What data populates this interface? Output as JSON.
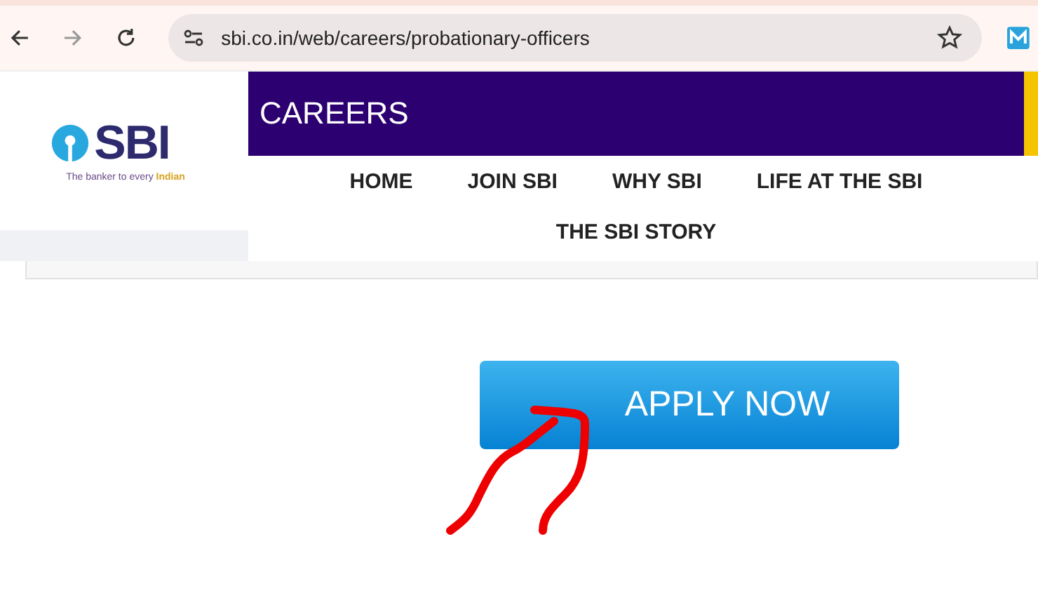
{
  "browser": {
    "url": "sbi.co.in/web/careers/probationary-officers",
    "bookmarked": false
  },
  "logo": {
    "name": "SBI",
    "tagline": "The banker to every ",
    "tagline_highlight": "Indian"
  },
  "header": {
    "title": "CAREERS"
  },
  "nav": [
    {
      "label": "HOME"
    },
    {
      "label": "JOIN SBI"
    },
    {
      "label": "WHY SBI"
    },
    {
      "label": "LIFE AT THE SBI"
    },
    {
      "label": "THE SBI STORY"
    }
  ],
  "cta": {
    "label": "APPLY NOW"
  }
}
